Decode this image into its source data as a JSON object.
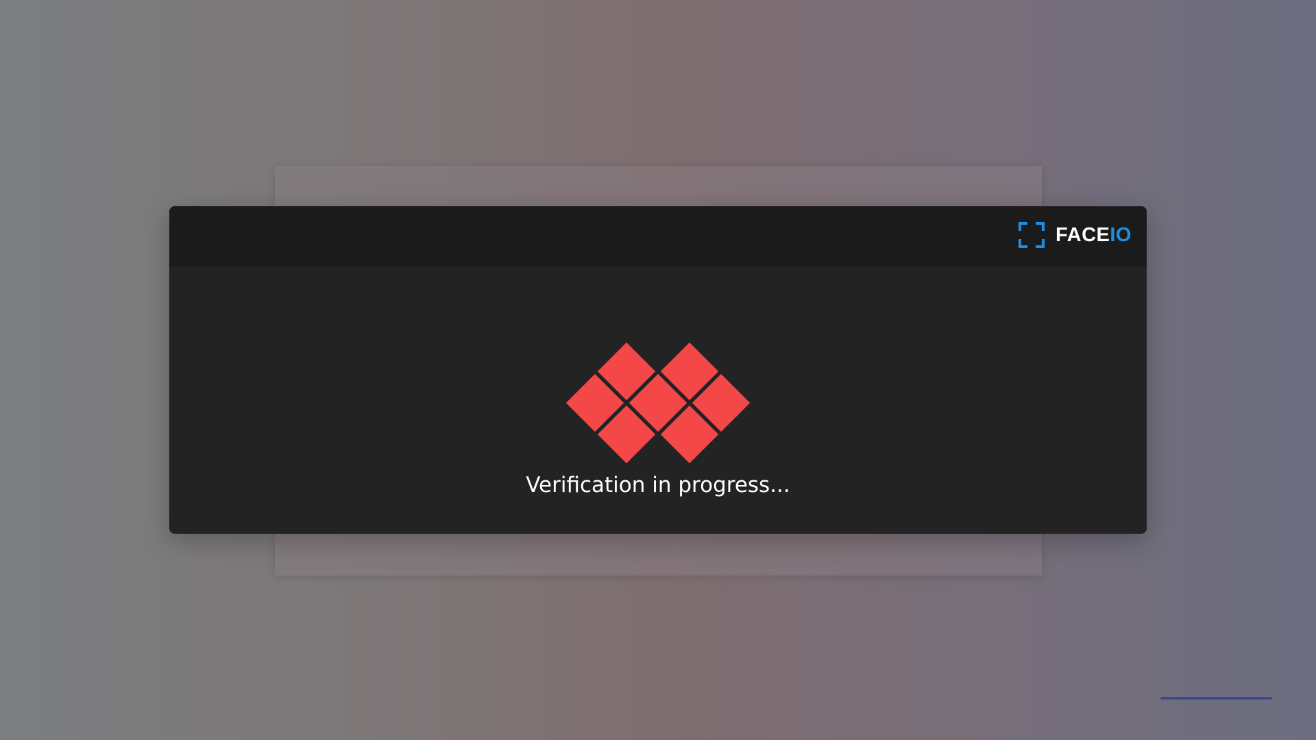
{
  "modal": {
    "brand": {
      "name_primary": "FACE",
      "name_accent": "IO",
      "icon": "scan-frame-icon",
      "accent_color": "#1f8fe5"
    },
    "loader": {
      "icon": "diamond-loader-icon",
      "color": "#f44848"
    },
    "status_text": "Verification in progress..."
  },
  "colors": {
    "modal_body": "#232323",
    "modal_header": "#1b1b1b"
  }
}
